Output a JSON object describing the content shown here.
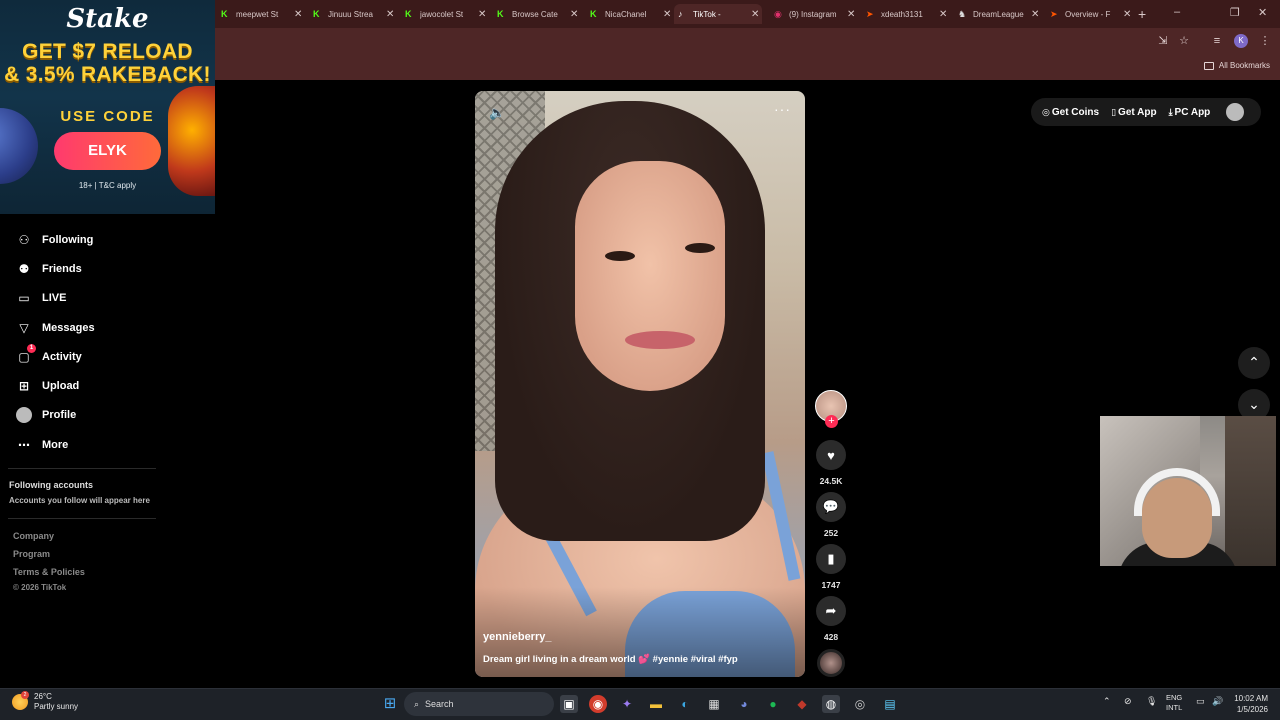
{
  "browser": {
    "tabs": [
      {
        "title": "meepwet St",
        "icon": "kick-icon",
        "active": false
      },
      {
        "title": "Jinuuu Strea",
        "icon": "kick-icon",
        "active": false
      },
      {
        "title": "jawocolet St",
        "icon": "kick-icon",
        "active": false
      },
      {
        "title": "Browse Cate",
        "icon": "kick-icon",
        "active": false
      },
      {
        "title": "NicaChanel",
        "icon": "kick-icon",
        "active": false
      },
      {
        "title": "TikTok -",
        "icon": "tiktok-icon",
        "active": true
      },
      {
        "title": "(9) Instagram",
        "icon": "instagram-icon",
        "active": false
      },
      {
        "title": "xdeath3131",
        "icon": "faceit-icon",
        "active": false
      },
      {
        "title": "DreamLeague",
        "icon": "dreamleague-icon",
        "active": false
      },
      {
        "title": "Overview - F",
        "icon": "faceit-icon",
        "active": false
      }
    ],
    "profile_initial": "K",
    "all_bookmarks": "All Bookmarks"
  },
  "ad": {
    "logo": "Stake",
    "headline_1": "GET $7 RELOAD",
    "headline_2": "& 3.5% RAKEBACK!",
    "use_code": "USE CODE",
    "code": "ELYK",
    "disclaimer": "18+ | T&C apply"
  },
  "nav": {
    "items": [
      {
        "label": "Following",
        "icon": "following-icon"
      },
      {
        "label": "Friends",
        "icon": "friends-icon"
      },
      {
        "label": "LIVE",
        "icon": "live-icon"
      },
      {
        "label": "Messages",
        "icon": "messages-icon"
      },
      {
        "label": "Activity",
        "icon": "activity-icon",
        "badge": "1"
      },
      {
        "label": "Upload",
        "icon": "upload-icon"
      },
      {
        "label": "Profile",
        "icon": "profile-avatar"
      },
      {
        "label": "More",
        "icon": "more-icon"
      }
    ],
    "following_accounts_title": "Following accounts",
    "following_accounts_sub": "Accounts you follow will appear here",
    "footer": [
      "Company",
      "Program",
      "Terms & Policies",
      "© 2026 TikTok"
    ]
  },
  "header": {
    "get_coins": "Get Coins",
    "get_app": "Get App",
    "pc_app": "PC App"
  },
  "video": {
    "username": "yennieberry_",
    "caption": "Dream girl living in a dream world 💕 #yennie #viral #fyp",
    "likes": "24.5K",
    "comments": "252",
    "saves": "1747",
    "shares": "428"
  },
  "taskbar": {
    "temperature": "26°C",
    "weather": "Partly sunny",
    "weather_badge": "2",
    "search": "Search",
    "lang_1": "ENG",
    "lang_2": "INTL",
    "time": "10:02 AM",
    "date": "1/5/2026"
  },
  "colors": {
    "tiktok_red": "#fe2c55",
    "chrome_frame": "#3b1a1a",
    "stake_yellow": "#ffd23a"
  }
}
